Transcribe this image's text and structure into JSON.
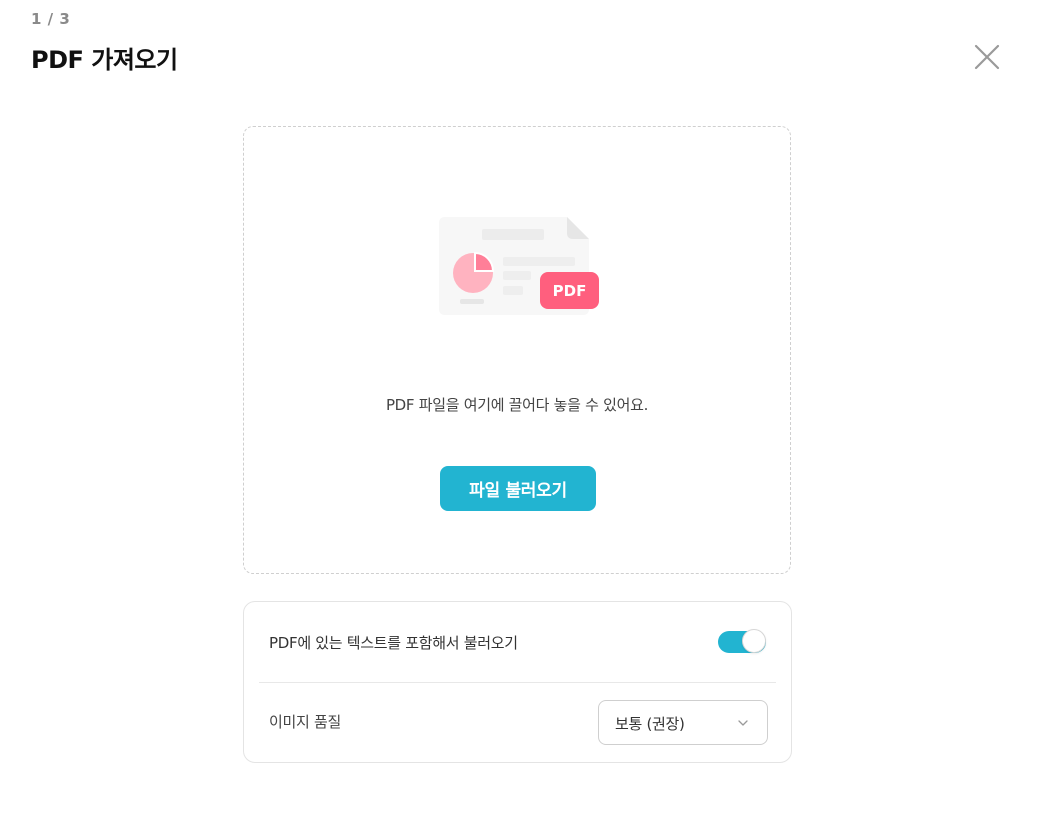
{
  "header": {
    "step": "1 / 3",
    "title": "PDF 가져오기"
  },
  "dropzone": {
    "badge": "PDF",
    "text": "PDF 파일을 여기에 끌어다 놓을 수 있어요.",
    "button_label": "파일 불러오기"
  },
  "options": {
    "include_text_label": "PDF에 있는 텍스트를 포함해서 불러오기",
    "include_text_enabled": true,
    "image_quality_label": "이미지 품질",
    "image_quality_value": "보통 (권장)"
  },
  "colors": {
    "accent": "#22b4d1",
    "badge": "#ff5f7e",
    "pie": "#ffb3c0"
  },
  "icons": {
    "close": "close-icon",
    "illustration": "pdf-document-illustration",
    "chevron": "chevron-down-icon"
  }
}
